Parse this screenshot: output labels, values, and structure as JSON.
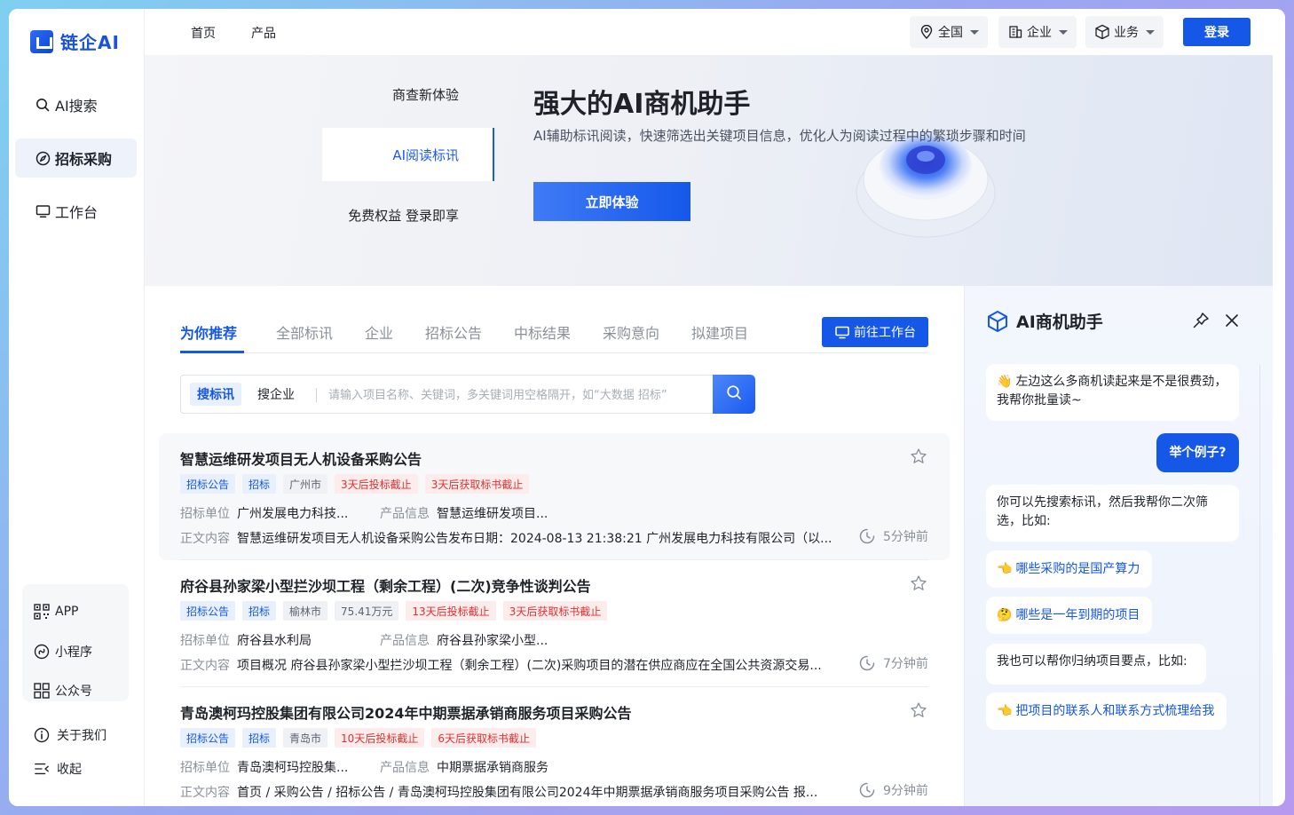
{
  "app": {
    "logo_text": "链企AI"
  },
  "sidebar": {
    "items": [
      {
        "label": "AI搜索",
        "icon": "search-icon"
      },
      {
        "label": "招标采购",
        "icon": "compass-icon",
        "active": true
      },
      {
        "label": "工作台",
        "icon": "monitor-icon"
      }
    ],
    "apps": [
      {
        "label": "APP",
        "icon": "qrcode-icon"
      },
      {
        "label": "小程序",
        "icon": "miniprogram-icon"
      },
      {
        "label": "公众号",
        "icon": "grid-icon"
      }
    ],
    "bottom": [
      {
        "label": "关于我们",
        "icon": "info-icon"
      },
      {
        "label": "收起",
        "icon": "collapse-icon"
      }
    ]
  },
  "header": {
    "links": [
      "首页",
      "产品"
    ],
    "filters": [
      {
        "label": "全国",
        "icon": "location-icon"
      },
      {
        "label": "企业",
        "icon": "building-icon"
      },
      {
        "label": "业务",
        "icon": "cube-icon"
      }
    ],
    "login_label": "登录"
  },
  "banner": {
    "tabs": [
      "商查新体验",
      "AI阅读标讯",
      "免费权益 登录即享"
    ],
    "active_tab": 1,
    "title": "强大的AI商机助手",
    "subtitle": "AI辅助标讯阅读，快速筛选出关键项目信息，优化人为阅读过程中的繁琐步骤和时间",
    "cta_label": "立即体验"
  },
  "main": {
    "tabs": [
      "为你推荐",
      "全部标讯",
      "企业",
      "招标公告",
      "中标结果",
      "采购意向",
      "拟建项目"
    ],
    "active_tab": 0,
    "workbench_label": "前往工作台",
    "search": {
      "seg_active": "搜标讯",
      "seg_other": "搜企业",
      "placeholder": "请输入项目名称、关键词，多关键词用空格隔开，如“大数据 招标”"
    },
    "labels": {
      "unit": "招标单位",
      "product": "产品信息",
      "content": "正文内容"
    },
    "cards": [
      {
        "title": "智慧运维研发项目无人机设备采购公告",
        "tags": [
          {
            "text": "招标公告",
            "kind": "blue"
          },
          {
            "text": "招标",
            "kind": "blue"
          },
          {
            "text": "广州市",
            "kind": "gray"
          },
          {
            "text": "3天后投标截止",
            "kind": "red"
          },
          {
            "text": "3天后获取标书截止",
            "kind": "red"
          }
        ],
        "unit": "广州发展电力科技...",
        "product": "智慧运维研发项目...",
        "content": "智慧运维研发项目无人机设备采购公告发布日期：2024-08-13 21:38:21 广州发展电力科技有限公司（以...",
        "time": "5分钟前"
      },
      {
        "title": "府谷县孙家梁小型拦沙坝工程（剩余工程）(二次)竞争性谈判公告",
        "tags": [
          {
            "text": "招标公告",
            "kind": "blue"
          },
          {
            "text": "招标",
            "kind": "blue"
          },
          {
            "text": "榆林市",
            "kind": "gray"
          },
          {
            "text": "75.41万元",
            "kind": "gray"
          },
          {
            "text": "13天后投标截止",
            "kind": "red"
          },
          {
            "text": "3天后获取标书截止",
            "kind": "red"
          }
        ],
        "unit": "府谷县水利局",
        "product": "府谷县孙家梁小型...",
        "content": "项目概况 府谷县孙家梁小型拦沙坝工程（剩余工程）(二次)采购项目的潜在供应商应在全国公共资源交易...",
        "time": "7分钟前"
      },
      {
        "title": "青岛澳柯玛控股集团有限公司2024年中期票据承销商服务项目采购公告",
        "tags": [
          {
            "text": "招标公告",
            "kind": "blue"
          },
          {
            "text": "招标",
            "kind": "blue"
          },
          {
            "text": "青岛市",
            "kind": "gray"
          },
          {
            "text": "10天后投标截止",
            "kind": "red"
          },
          {
            "text": "6天后获取标书截止",
            "kind": "red"
          }
        ],
        "unit": "青岛澳柯玛控股集...",
        "product": "中期票据承销商服务",
        "content": "首页 / 采购公告 / 招标公告 / 青岛澳柯玛控股集团有限公司2024年中期票据承销商服务项目采购公告 报...",
        "time": "9分钟前"
      }
    ]
  },
  "assistant": {
    "title": "AI商机助手",
    "messages": {
      "m1_emoji": "👋",
      "m1": "左边这么多商机读起来是不是很费劲，我帮你批量读~",
      "user": "举个例子?",
      "m2": "你可以先搜索标讯，然后我帮你二次筛选，比如:",
      "s1_emoji": "👈",
      "s1": "哪些采购的是国产算力",
      "s2_emoji": "🤔",
      "s2": "哪些是一年到期的项目",
      "m3": "我也可以帮你归纳项目要点，比如:",
      "s3_emoji": "👈",
      "s3": "把项目的联系人和联系方式梳理给我"
    }
  },
  "colors": {
    "accent": "#1557e6",
    "tag_red": "#e0312f",
    "tag_blue_bg": "#e8effd"
  }
}
